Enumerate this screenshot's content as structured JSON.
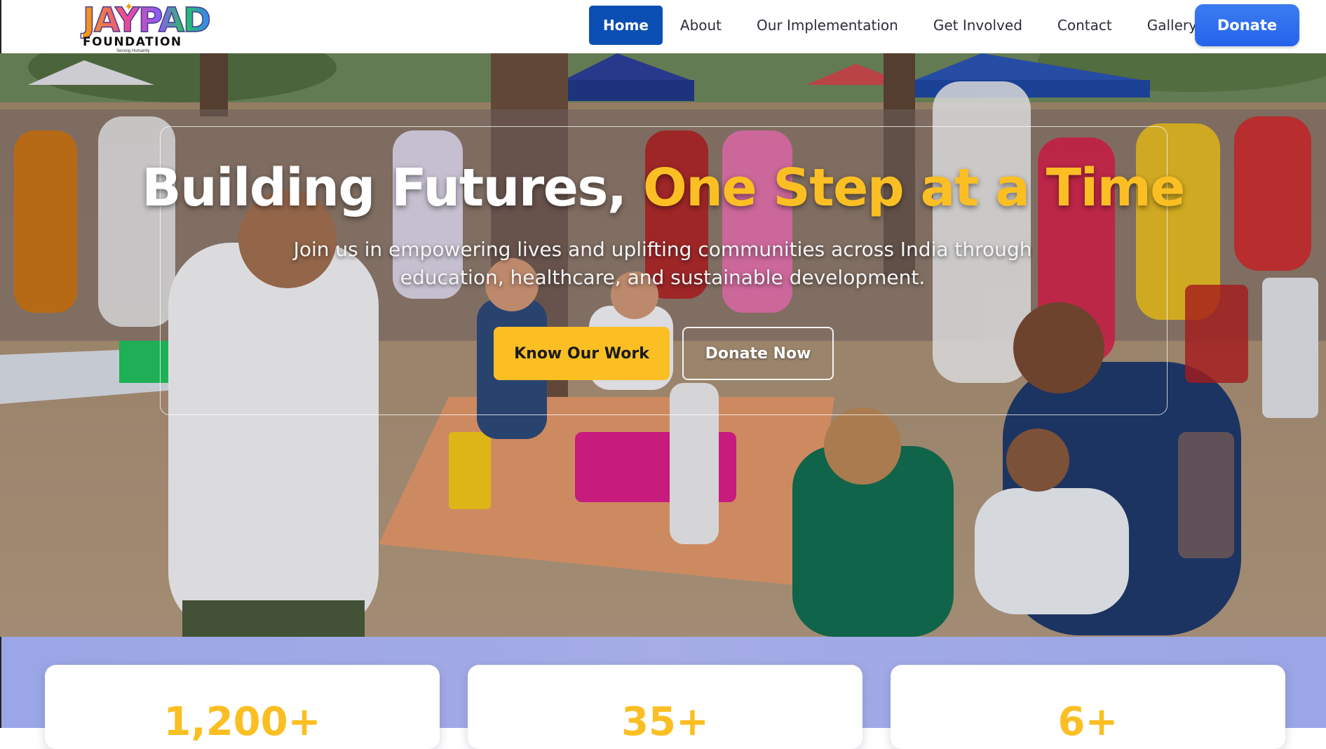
{
  "nav": {
    "logo": {
      "brand": "JAYPAD",
      "name": "FOUNDATION",
      "tagline": "Serving Humanity"
    },
    "links": [
      {
        "label": "Home",
        "active": true
      },
      {
        "label": "About",
        "active": false
      },
      {
        "label": "Our Implementation",
        "active": false
      },
      {
        "label": "Get Involved",
        "active": false
      },
      {
        "label": "Contact",
        "active": false
      },
      {
        "label": "Gallery",
        "active": false
      }
    ],
    "donate_label": "Donate"
  },
  "hero": {
    "title_main": "Building Futures, ",
    "title_accent": "One Step at a Time",
    "subtitle": "Join us in empowering lives and uplifting communities across India through education, healthcare, and sustainable development.",
    "primary_button": "Know Our Work",
    "secondary_button": "Donate Now",
    "background_image": "community health camp photo"
  },
  "stats": [
    {
      "value": "1,200+"
    },
    {
      "value": "35+"
    },
    {
      "value": "6+"
    }
  ],
  "colors": {
    "accent": "#fbbf24",
    "primary_blue": "#0b4fb4",
    "donate_blue": "#2563eb",
    "stats_band": "#9aa6e6"
  }
}
